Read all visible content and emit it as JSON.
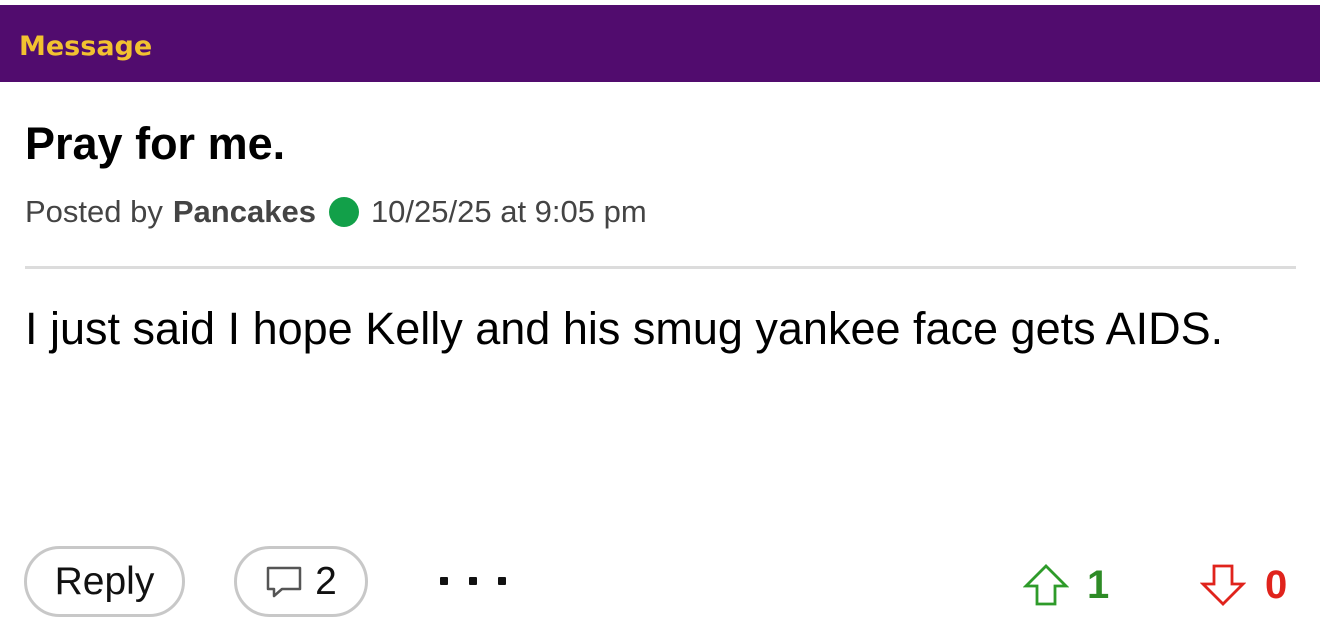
{
  "header": {
    "title": "Message",
    "bg_color": "#510c6e",
    "title_color": "#f2c230"
  },
  "post": {
    "title": "Pray for me.",
    "posted_by_label": "Posted by",
    "author": "Pancakes",
    "online_status": "online",
    "online_color": "#12a049",
    "timestamp": "10/25/25 at 9:05 pm",
    "body": "I just said I hope Kelly and his smug yankee face gets AIDS."
  },
  "actions": {
    "reply_label": "Reply",
    "comment_icon": "speech-bubble-icon",
    "comment_count": "2",
    "more_icon": "ellipsis-icon",
    "upvote_icon": "arrow-up-icon",
    "upvote_count": "1",
    "upvote_color": "#2e8b26",
    "downvote_icon": "arrow-down-icon",
    "downvote_count": "0",
    "downvote_color": "#e0231c"
  }
}
